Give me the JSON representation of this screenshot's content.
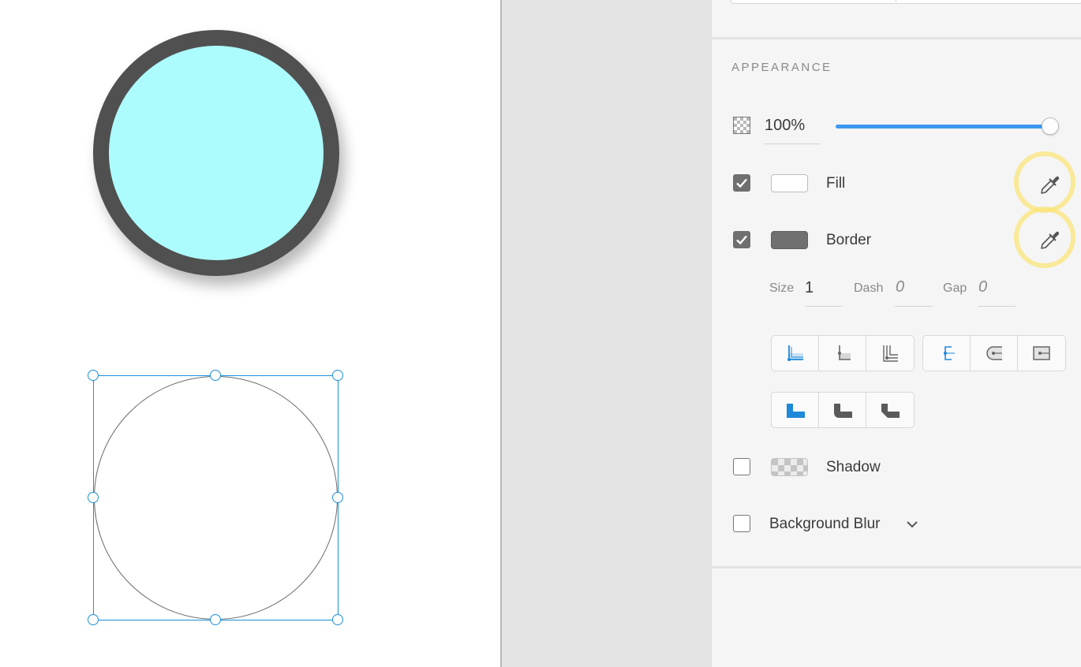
{
  "panel": {
    "section_title": "APPEARANCE",
    "opacity": {
      "value_label": "100%",
      "slider_fraction": 1.0
    },
    "fill": {
      "label": "Fill",
      "checked": true,
      "swatch_color": "#ffffff"
    },
    "border": {
      "label": "Border",
      "checked": true,
      "swatch_color": "#707070",
      "size_label": "Size",
      "size_value": "1",
      "dash_label": "Dash",
      "dash_value": "0",
      "gap_label": "Gap",
      "gap_value": "0"
    },
    "shadow": {
      "label": "Shadow",
      "checked": false
    },
    "background_blur": {
      "label": "Background Blur",
      "checked": false
    }
  },
  "canvas": {
    "filled_circle": {
      "fill_color": "#adfcfd",
      "border_color": "#505050"
    },
    "selected_circle": {
      "border_color": "#6a6a6a",
      "selection_color": "#1b8fd8"
    }
  },
  "colors": {
    "accent": "#3b99ef",
    "eyedropper_highlight": "#fae478"
  }
}
